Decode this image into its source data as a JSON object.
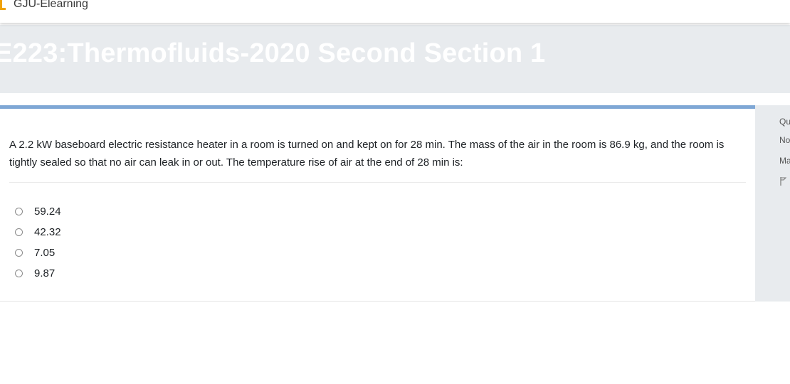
{
  "topbar": {
    "brand": "GJU-Elearning",
    "brand_icon": "site-logo-icon"
  },
  "course": {
    "title": "E223:Thermofluids-2020 Second Section 1"
  },
  "question": {
    "text": "A 2.2 kW baseboard electric resistance heater in a room is turned on and kept on for 28 min. The mass of the air in the room is 86.9 kg, and the room is tightly sealed so that no air can leak in or out. The temperature rise of air at the end of 28 min is:",
    "options": [
      "59.24",
      "42.32",
      "7.05",
      "9.87"
    ]
  },
  "info_panel": {
    "line1": "Qu",
    "line2": "No",
    "line3": "Ma",
    "flag_icon": "flag-icon"
  },
  "colors": {
    "accent": "#7fa7d5",
    "brand": "#f0a30a",
    "header_bg": "#e8ebee"
  }
}
